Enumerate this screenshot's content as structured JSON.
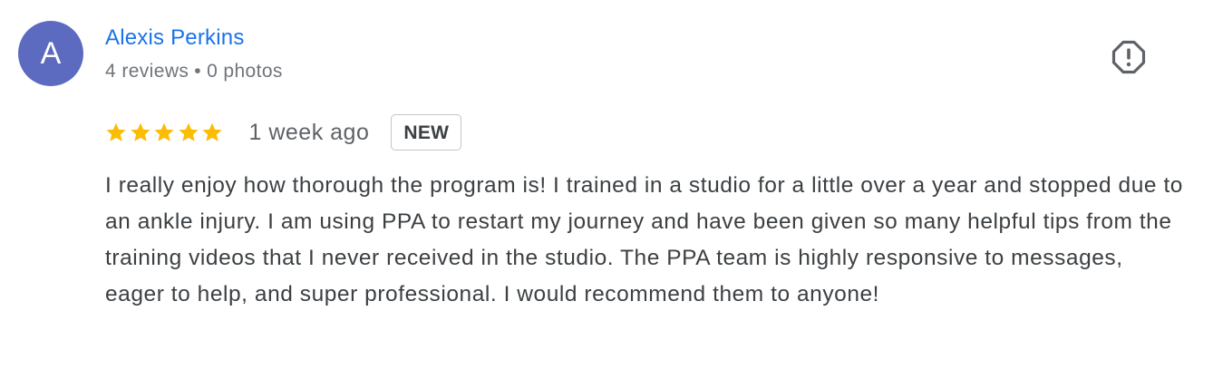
{
  "reviewer": {
    "avatar_initial": "A",
    "avatar_color": "#5c6bc0",
    "name": "Alexis Perkins",
    "reviews_count": "4 reviews",
    "separator": "•",
    "photos_count": "0 photos"
  },
  "actions": {
    "report_icon": "report-flag-icon"
  },
  "rating": {
    "stars": 5,
    "max_stars": 5,
    "star_color": "#fbbc04",
    "date": "1 week ago",
    "badge": "NEW"
  },
  "review": {
    "text": "I really enjoy how thorough the program is! I trained in a studio for a little over a year and stopped due to an ankle injury. I am using PPA to restart my journey and have been given so many helpful tips from the training videos that I never received in the studio. The PPA team is highly responsive to messages, eager to help, and super professional. I would recommend them to anyone!"
  }
}
